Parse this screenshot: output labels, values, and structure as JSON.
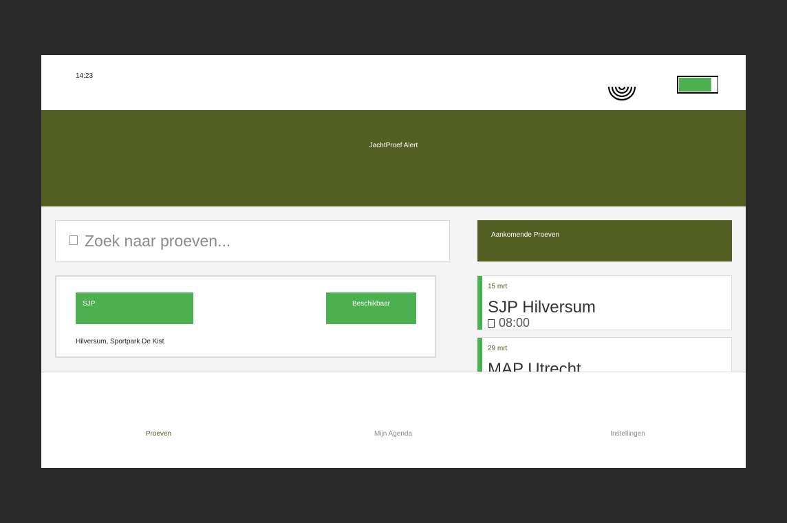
{
  "status_bar": {
    "time": "14:23",
    "wifi_icon": "wifi-icon",
    "battery_icon": "battery-icon",
    "battery_level": 0.85,
    "battery_color": "#4caf50"
  },
  "app_bar": {
    "title": "JachtProef Alert",
    "color": "#535e22"
  },
  "search": {
    "icon": "search-icon",
    "placeholder": "Zoek naar proeven..."
  },
  "trial_card": {
    "type": "SJP",
    "status": "Beschikbaar",
    "location": "Hilversum, Sportpark De Kist",
    "badge_color": "#4caf50"
  },
  "upcoming": {
    "title": "Aankomende Proeven",
    "events": [
      {
        "date": "15 mrt",
        "name": "SJP Hilversum",
        "time": "08:00"
      },
      {
        "date": "29 mrt",
        "name": "MAP Utrecht",
        "time": ""
      }
    ]
  },
  "bottom_nav": {
    "items": [
      {
        "label": "Proeven",
        "active": true
      },
      {
        "label": "Mijn Agenda",
        "active": false
      },
      {
        "label": "Instellingen",
        "active": false
      }
    ],
    "active_color": "#535e22"
  }
}
